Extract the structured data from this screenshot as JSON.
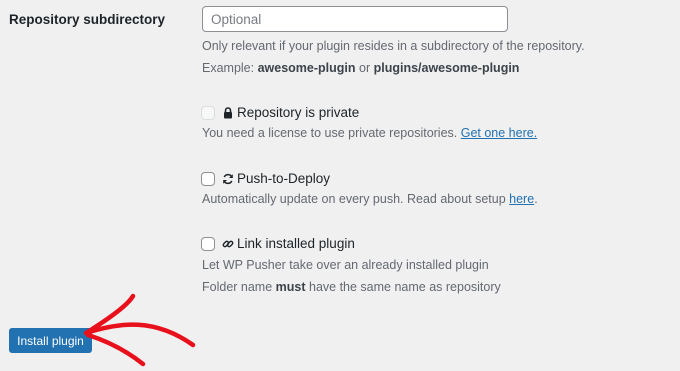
{
  "form": {
    "subdirectory": {
      "label": "Repository subdirectory",
      "placeholder": "Optional",
      "value": "",
      "help_line1": "Only relevant if your plugin resides in a subdirectory of the repository.",
      "example_prefix": "Example: ",
      "example_a": "awesome-plugin",
      "example_or": " or ",
      "example_b": "plugins/awesome-plugin"
    },
    "private": {
      "label": "Repository is private",
      "icon": "lock-icon",
      "checked": false,
      "disabled": true,
      "help_text": "You need a license to use private repositories. ",
      "help_link": "Get one here."
    },
    "push_to_deploy": {
      "label": "Push-to-Deploy",
      "icon": "sync-icon",
      "checked": false,
      "help_text": "Automatically update on every push. Read about setup ",
      "help_link": "here",
      "help_suffix": "."
    },
    "link_installed": {
      "label": "Link installed plugin",
      "icon": "link-icon",
      "checked": false,
      "help_line1": "Let WP Pusher take over an already installed plugin",
      "help_line2_prefix": "Folder name ",
      "help_line2_bold": "must",
      "help_line2_suffix": " have the same name as repository"
    }
  },
  "actions": {
    "install_label": "Install plugin"
  },
  "colors": {
    "background": "#f0f0f1",
    "primary_button": "#2271b1",
    "link": "#2271b1",
    "annotation_arrow": "#e8101a"
  }
}
